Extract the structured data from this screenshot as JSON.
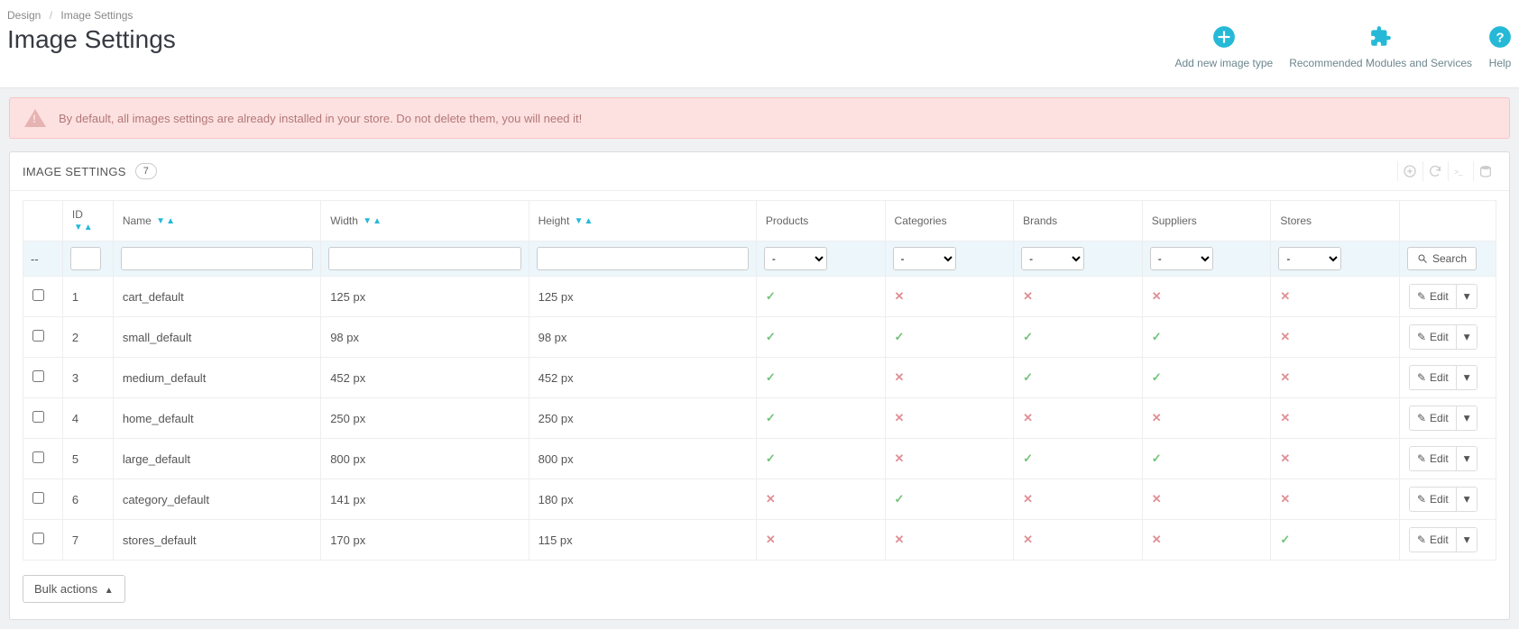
{
  "breadcrumb": {
    "parent": "Design",
    "current": "Image Settings"
  },
  "page_title": "Image Settings",
  "toolbar": {
    "add_label": "Add new image type",
    "modules_label": "Recommended Modules and Services",
    "help_label": "Help"
  },
  "alert_text": "By default, all images settings are already installed in your store. Do not delete them, you will need it!",
  "panel": {
    "title": "IMAGE SETTINGS",
    "count": "7"
  },
  "columns": {
    "id": "ID",
    "name": "Name",
    "width": "Width",
    "height": "Height",
    "products": "Products",
    "categories": "Categories",
    "brands": "Brands",
    "suppliers": "Suppliers",
    "stores": "Stores"
  },
  "filter": {
    "dash": "--",
    "select_placeholder": "-",
    "search_label": "Search"
  },
  "actions": {
    "edit": "Edit",
    "bulk": "Bulk actions"
  },
  "rows": [
    {
      "id": "1",
      "name": "cart_default",
      "width": "125 px",
      "height": "125 px",
      "products": true,
      "categories": false,
      "brands": false,
      "suppliers": false,
      "stores": false
    },
    {
      "id": "2",
      "name": "small_default",
      "width": "98 px",
      "height": "98 px",
      "products": true,
      "categories": true,
      "brands": true,
      "suppliers": true,
      "stores": false
    },
    {
      "id": "3",
      "name": "medium_default",
      "width": "452 px",
      "height": "452 px",
      "products": true,
      "categories": false,
      "brands": true,
      "suppliers": true,
      "stores": false
    },
    {
      "id": "4",
      "name": "home_default",
      "width": "250 px",
      "height": "250 px",
      "products": true,
      "categories": false,
      "brands": false,
      "suppliers": false,
      "stores": false
    },
    {
      "id": "5",
      "name": "large_default",
      "width": "800 px",
      "height": "800 px",
      "products": true,
      "categories": false,
      "brands": true,
      "suppliers": true,
      "stores": false
    },
    {
      "id": "6",
      "name": "category_default",
      "width": "141 px",
      "height": "180 px",
      "products": false,
      "categories": true,
      "brands": false,
      "suppliers": false,
      "stores": false
    },
    {
      "id": "7",
      "name": "stores_default",
      "width": "170 px",
      "height": "115 px",
      "products": false,
      "categories": false,
      "brands": false,
      "suppliers": false,
      "stores": true
    }
  ]
}
